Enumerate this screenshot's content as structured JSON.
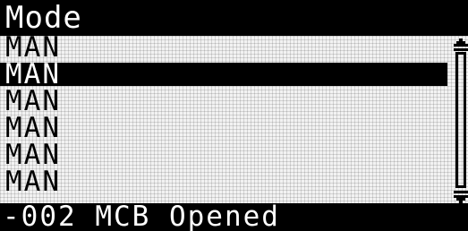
{
  "header": {
    "title": "Mode"
  },
  "list": {
    "items": [
      {
        "label": "MAN"
      },
      {
        "label": "MAN"
      },
      {
        "label": "MAN"
      },
      {
        "label": "MAN"
      },
      {
        "label": "MAN"
      },
      {
        "label": "MAN"
      }
    ],
    "selected_index": 1
  },
  "status": {
    "text": "-002 MCB Opened"
  },
  "colors": {
    "background": "#f2f2f2",
    "foreground": "#000000",
    "inverse_text": "#ffffff"
  },
  "icons": {
    "scroll_up": "scroll-up-arrow-icon",
    "scroll_down": "scroll-down-arrow-icon"
  }
}
